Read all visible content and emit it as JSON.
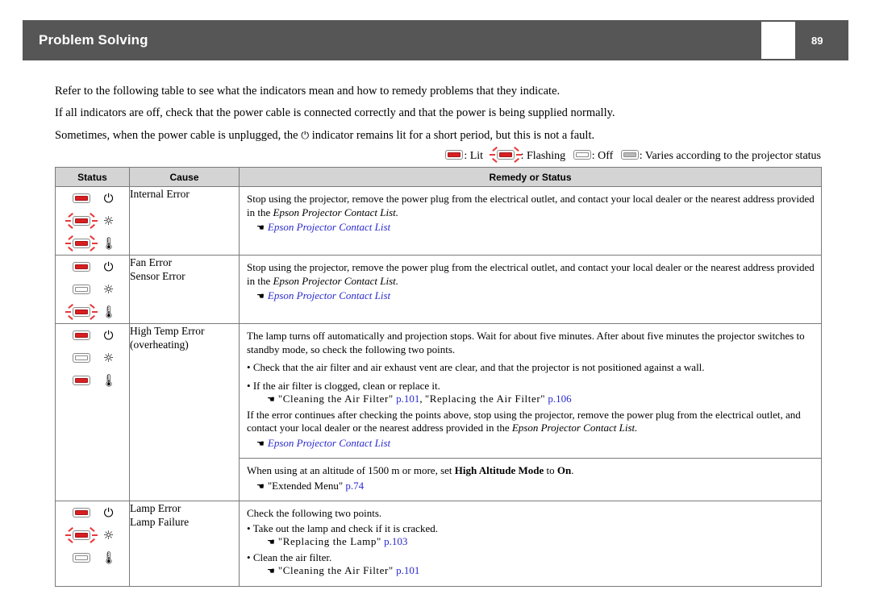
{
  "header": {
    "title": "Problem Solving",
    "page_number": "89"
  },
  "intro": {
    "paragraphs": [
      "Refer to the following table to see what the indicators mean and how to remedy problems that they indicate.",
      "If all indicators are off, check that the power cable is connected correctly and that the power is being supplied normally.",
      "Sometimes, when the power cable is unplugged, the ⏻ indicator remains lit for a short period, but this is not a fault."
    ],
    "para3_before": "Sometimes, when the power cable is unplugged, the ",
    "para3_symbol": "⏻",
    "para3_after": " indicator remains lit for a short period, but this is not a fault."
  },
  "legend": {
    "items": [
      {
        "state": "lit",
        "label": ": Lit"
      },
      {
        "state": "flash",
        "label": ": Flashing"
      },
      {
        "state": "off",
        "label": ": Off"
      },
      {
        "state": "vary",
        "label": ": Varies according to the projector status"
      }
    ]
  },
  "colors": {
    "header_bar": "#565656",
    "lit_red": "#d81f22",
    "flash_ray": "#e8393b",
    "varies_gray": "#b9b9b9",
    "table_header_bg": "#d4d4d4",
    "link_blue": "#2a2ad0"
  },
  "table": {
    "columns": [
      "Status",
      "Cause",
      "Remedy or Status"
    ],
    "rows": [
      {
        "indicators": [
          {
            "symbol": "power",
            "state": "lit"
          },
          {
            "symbol": "lamp",
            "state": "flash"
          },
          {
            "symbol": "temp",
            "state": "flash"
          }
        ],
        "cause": [
          "Internal Error"
        ],
        "remedy": [
          {
            "lines": [
              {
                "type": "text",
                "text": "Stop using the projector, remove the power plug from the electrical outlet, and contact your local dealer or the nearest address provided in the "
              },
              {
                "type": "italic_tail",
                "text": "Epson Projector Contact List."
              },
              {
                "type": "ref",
                "label": "Epson Projector Contact List"
              }
            ]
          }
        ]
      },
      {
        "indicators": [
          {
            "symbol": "power",
            "state": "lit"
          },
          {
            "symbol": "lamp",
            "state": "off"
          },
          {
            "symbol": "temp",
            "state": "flash"
          }
        ],
        "cause": [
          "Fan Error",
          "Sensor Error"
        ],
        "remedy": [
          {
            "lines": [
              {
                "type": "text",
                "text": "Stop using the projector, remove the power plug from the electrical outlet, and contact your local dealer or the nearest address provided in the "
              },
              {
                "type": "italic_tail",
                "text": "Epson Projector Contact List."
              },
              {
                "type": "ref",
                "label": "Epson Projector Contact List"
              }
            ]
          }
        ]
      },
      {
        "indicators": [
          {
            "symbol": "power",
            "state": "lit"
          },
          {
            "symbol": "lamp",
            "state": "off"
          },
          {
            "symbol": "temp",
            "state": "lit"
          }
        ],
        "cause": [
          "High Temp Error",
          "(overheating)"
        ],
        "remedy": [
          {
            "intro": "The lamp turns off automatically and projection stops. Wait for about five minutes. After about five minutes the projector switches to standby mode, so check the following two points.",
            "bullet1": "Check that the air filter and air exhaust vent are clear, and that the projector is not positioned against a wall.",
            "bullet2": "If the air filter is clogged, clean or replace it.",
            "ref_a_title": "\"Cleaning the Air Filter\"",
            "ref_a_page": "p.101",
            "ref_a_sep": ", ",
            "ref_b_title": "\"Replacing the Air Filter\"",
            "ref_b_page": "p.106",
            "closing_pre": "If the error continues after checking the points above, stop using the projector, remove the power plug from the electrical outlet, and contact your local dealer or the nearest address provided in the ",
            "closing_ital": "Epson Projector Contact List.",
            "contact_ref": "Epson Projector Contact List"
          },
          {
            "alt_pre": "When using at an altitude of 1500 m or more, set ",
            "alt_bold1": "High Altitude Mode",
            "alt_mid": " to ",
            "alt_bold2": "On",
            "alt_end": ".",
            "alt_ref_title": "\"Extended Menu\"",
            "alt_ref_page": "p.74"
          }
        ]
      },
      {
        "indicators": [
          {
            "symbol": "power",
            "state": "lit"
          },
          {
            "symbol": "lamp",
            "state": "flash"
          },
          {
            "symbol": "temp",
            "state": "off"
          }
        ],
        "cause": [
          "Lamp Error",
          "Lamp Failure"
        ],
        "remedy": [
          {
            "intro": "Check the following two points.",
            "bullet1": "Take out the lamp and check if it is cracked.",
            "ref1_title": "\"Replacing the Lamp\"",
            "ref1_page": "p.103",
            "bullet2": "Clean the air filter.",
            "ref2_title": "\"Cleaning the Air Filter\"",
            "ref2_page": "p.101"
          }
        ]
      }
    ]
  },
  "icons": {
    "power": "⏻",
    "lamp": "☼",
    "temp": "🌡"
  }
}
